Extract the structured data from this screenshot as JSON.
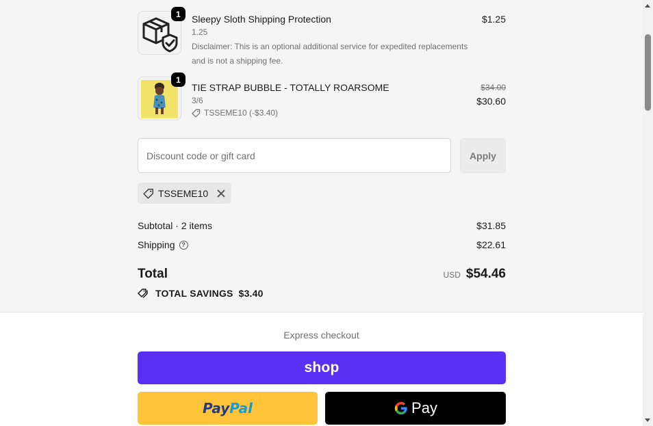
{
  "order_summary": {
    "items": [
      {
        "quantity": "1",
        "title": "Sleepy Sloth Shipping Protection",
        "variant": "1.25",
        "note_line1": "Disclaimer: This is an optional additional service for expedited replacements",
        "note_line2": "and is not a shipping fee.",
        "price": "$1.25",
        "icon": "package-shield-icon"
      },
      {
        "quantity": "1",
        "title": "TIE STRAP BUBBLE - TOTALLY ROARSOME",
        "variant": "3/6",
        "discount_label": "TSSEME10 (-$3.40)",
        "original_price": "$34.00",
        "price": "$30.60"
      }
    ],
    "discount": {
      "placeholder": "Discount code or gift card",
      "value": "",
      "apply_label": "Apply",
      "applied_code": "TSSEME10"
    },
    "subtotal_label": "Subtotal · 2 items",
    "subtotal_value": "$31.85",
    "shipping_label": "Shipping",
    "shipping_value": "$22.61",
    "total_label": "Total",
    "currency": "USD",
    "total_value": "$54.46",
    "savings_label": "TOTAL SAVINGS",
    "savings_value": "$3.40"
  },
  "express_checkout": {
    "title": "Express checkout",
    "shop_label": "shop",
    "paypal_part1": "Pay",
    "paypal_part2": "Pal",
    "gpay_label": "Pay"
  },
  "colors": {
    "shop_purple": "#5a31f4",
    "paypal_yellow": "#ffc439",
    "gpay_black": "#000000",
    "summary_bg": "#f5f5f5"
  }
}
